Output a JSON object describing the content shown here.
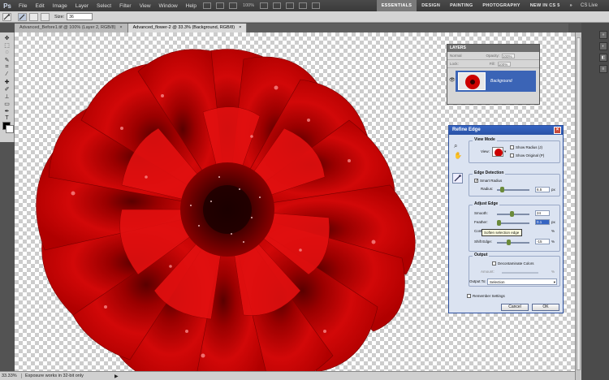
{
  "menubar": {
    "logo": "Ps",
    "items": [
      "File",
      "Edit",
      "Image",
      "Layer",
      "Select",
      "Filter",
      "View",
      "Window",
      "Help"
    ],
    "zoom_readout": "100%",
    "workspaces": [
      "ESSENTIALS",
      "DESIGN",
      "PAINTING",
      "PHOTOGRAPHY",
      "NEW IN CS 5"
    ],
    "workspace_more": "»",
    "cs_live": "CS Live"
  },
  "options_bar": {
    "size_label": "Size:",
    "size_value": "36"
  },
  "tabs": [
    {
      "label": "Advanced_Before1.tif @ 100% (Layer 2, RGB/8)",
      "active": false
    },
    {
      "label": "Advanced_flower-2 @ 33.3% (Background, RGB/8)",
      "active": true
    }
  ],
  "tab_close": "×",
  "status": {
    "zoom": "33.33%",
    "message": "Exposure works in 32-bit only",
    "arrow": "▶"
  },
  "layers_panel": {
    "title": "LAYERS",
    "blend_mode": "Normal",
    "opacity_label": "Opacity:",
    "opacity_value": "100%",
    "lock_label": "Lock:",
    "fill_label": "Fill:",
    "fill_value": "100%",
    "layer_name": "Background"
  },
  "refine_edge": {
    "title": "Refine Edge",
    "close": "×",
    "view_mode": {
      "title": "View Mode",
      "view_label": "View:",
      "show_radius": "Show Radius (J)",
      "show_original": "Show Original (P)"
    },
    "edge_detection": {
      "title": "Edge Detection",
      "smart_radius": "Smart Radius",
      "radius_label": "Radius:",
      "radius_value": "6.5",
      "radius_unit": "px"
    },
    "adjust_edge": {
      "title": "Adjust Edge",
      "smooth_label": "Smooth:",
      "smooth_value": "24",
      "feather_label": "Feather:",
      "feather_value": "0.1",
      "feather_unit": "px",
      "contrast_label": "Contrast:",
      "contrast_unit": "%",
      "shift_label": "Shift Edge:",
      "shift_value": "-15",
      "shift_unit": "%",
      "tooltip": "Soften selection edge"
    },
    "output": {
      "title": "Output",
      "decontaminate": "Decontaminate Colors",
      "amount_label": "Amount:",
      "amount_unit": "%",
      "output_to_label": "Output To:",
      "output_to_value": "Selection"
    },
    "remember": "Remember Settings",
    "cancel": "Cancel",
    "ok": "OK"
  }
}
